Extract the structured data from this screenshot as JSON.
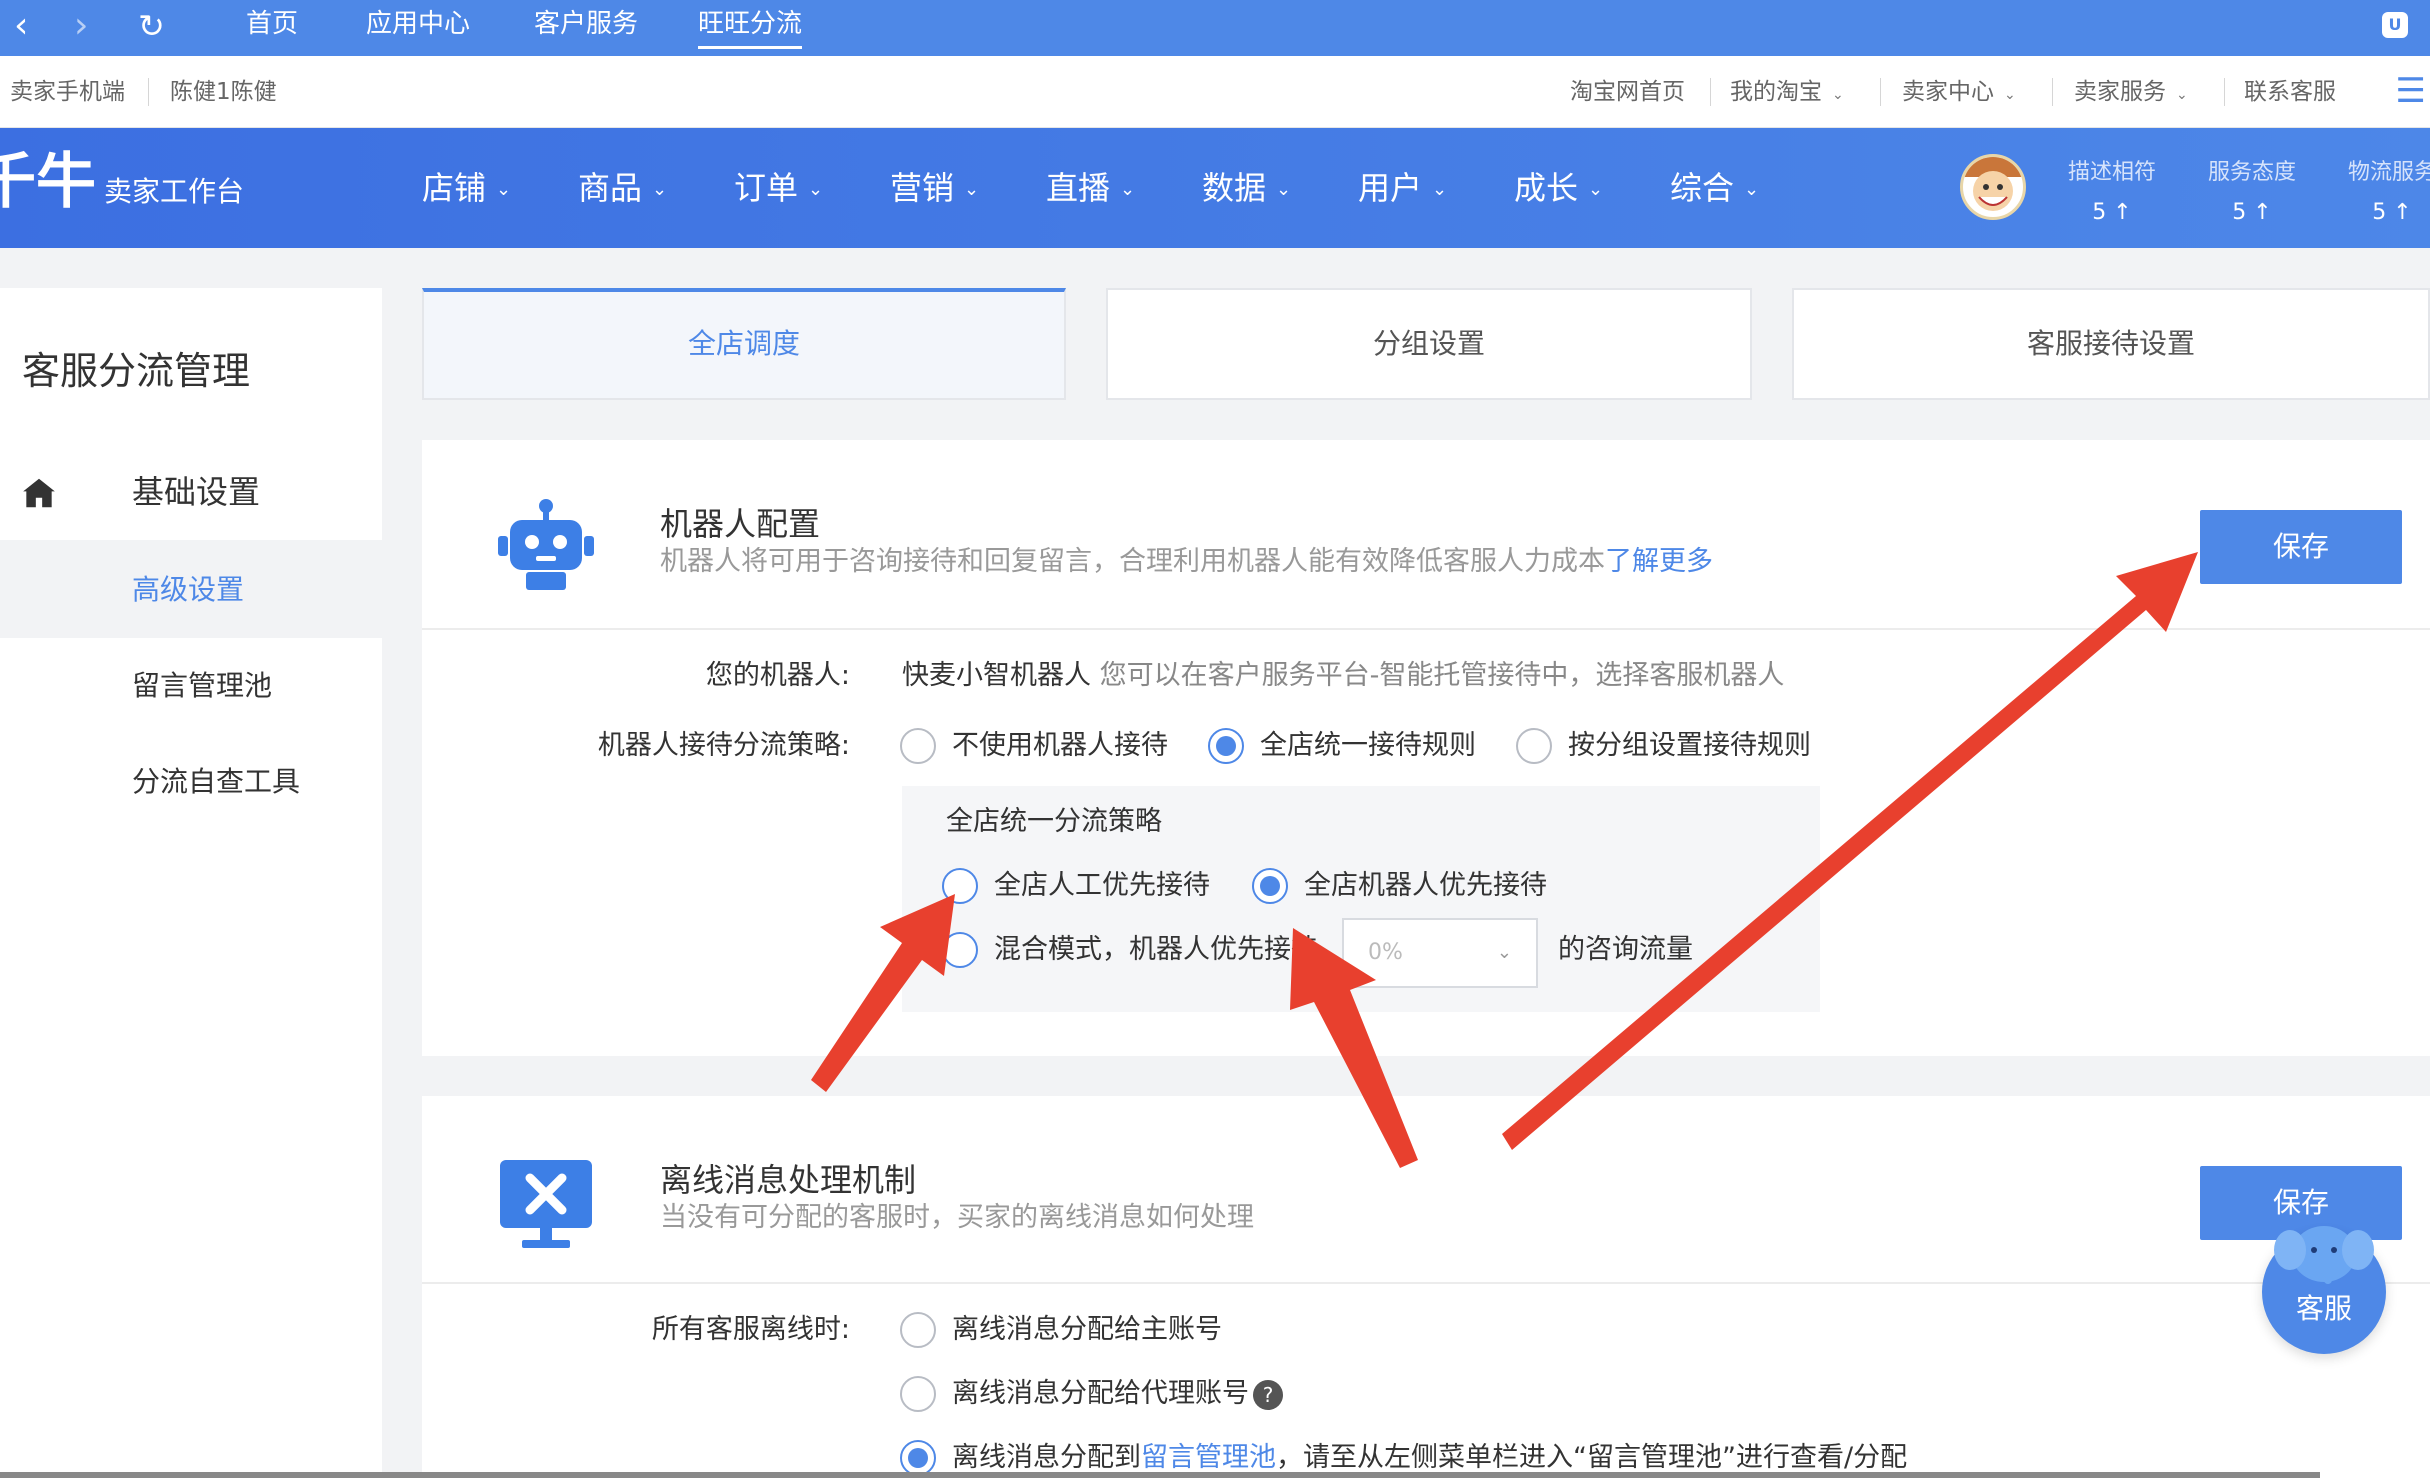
{
  "browser": {
    "tabs": [
      "首页",
      "应用中心",
      "客户服务",
      "旺旺分流"
    ],
    "active_tab": "旺旺分流",
    "ext_badge": "U"
  },
  "subbar": {
    "left": [
      "卖家手机端",
      "陈健1陈健"
    ],
    "right": [
      "淘宝网首页",
      "我的淘宝",
      "卖家中心",
      "卖家服务",
      "联系客服"
    ]
  },
  "header": {
    "logo": "千牛",
    "logo_sub": "卖家工作台",
    "nav": [
      "店铺",
      "商品",
      "订单",
      "营销",
      "直播",
      "数据",
      "用户",
      "成长",
      "综合"
    ],
    "ratings": [
      {
        "label": "描述相符",
        "value": "5 ↑"
      },
      {
        "label": "服务态度",
        "value": "5 ↑"
      },
      {
        "label": "物流服务",
        "value": "5 ↑"
      }
    ]
  },
  "sidebar": {
    "title": "客服分流管理",
    "items": [
      "基础设置",
      "高级设置",
      "留言管理池",
      "分流自查工具"
    ],
    "active": "高级设置"
  },
  "tabs": [
    "全店调度",
    "分组设置",
    "客服接待设置"
  ],
  "robot": {
    "title": "机器人配置",
    "desc": "机器人将可用于咨询接待和回复留言，合理利用机器人能有效降低客服人力成本",
    "learn_more": "了解更多",
    "save": "保存",
    "your_robot_label": "您的机器人:",
    "robot_name": "快麦小智机器人",
    "robot_hint": "您可以在客户服务平台-智能托管接待中，选择客服机器人",
    "strategy_label": "机器人接待分流策略:",
    "strategy_options": [
      "不使用机器人接待",
      "全店统一接待规则",
      "按分组设置接待规则"
    ],
    "strategy_selected": 1,
    "unified": {
      "title": "全店统一分流策略",
      "opt_human": "全店人工优先接待",
      "opt_robot": "全店机器人优先接待",
      "opt_mixed": "混合模式，机器人优先接待",
      "select_value": "0%",
      "traffic_suffix": "的咨询流量",
      "selected": "全店机器人优先接待"
    }
  },
  "offline": {
    "title": "离线消息处理机制",
    "desc": "当没有可分配的客服时，买家的离线消息如何处理",
    "save": "保存",
    "label": "所有客服离线时:",
    "options": [
      "离线消息分配给主账号",
      "离线消息分配给代理账号"
    ],
    "opt3_prefix": "离线消息分配到",
    "opt3_link": "留言管理池",
    "opt3_suffix": "，请至从左侧菜单栏进入“留言管理池”进行查看/分配",
    "selected_index": 2
  },
  "service_bubble": "客服",
  "colors": {
    "primary": "#4e88e7",
    "header_start": "#3c6fe1",
    "arrow": "#e8402e"
  }
}
